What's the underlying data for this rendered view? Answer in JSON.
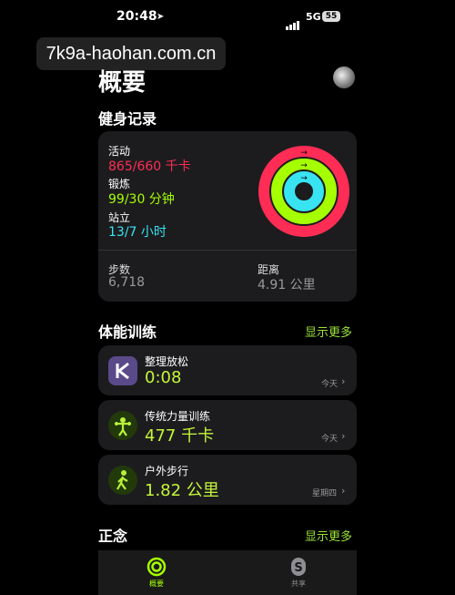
{
  "status": {
    "time": "20:48",
    "network": "5G",
    "battery": "55"
  },
  "watermark": "7k9a-haohan.com.cn",
  "header": {
    "title": "概要"
  },
  "fitness": {
    "section_title": "健身记录",
    "move": {
      "label": "活动",
      "value": "865/660 千卡"
    },
    "exercise": {
      "label": "锻炼",
      "value": "99/30 分钟"
    },
    "stand": {
      "label": "站立",
      "value": "13/7 小时"
    },
    "steps": {
      "label": "步数",
      "value": "6,718"
    },
    "distance": {
      "label": "距离",
      "value": "4.91 公里"
    },
    "ring_colors": {
      "move": "#ff2d55",
      "exercise": "#a6ff00",
      "stand": "#38e4f2"
    }
  },
  "workouts": {
    "section_title": "体能训练",
    "more": "显示更多",
    "items": [
      {
        "name": "整理放松",
        "value": "0:08",
        "date": "今天",
        "icon": "cooldown-k-icon"
      },
      {
        "name": "传统力量训练",
        "value": "477 千卡",
        "date": "今天",
        "icon": "weightlifting-icon"
      },
      {
        "name": "户外步行",
        "value": "1.82 公里",
        "date": "星期四",
        "icon": "walking-icon"
      }
    ]
  },
  "mindfulness": {
    "section_title": "正念",
    "more": "显示更多"
  },
  "tabs": [
    {
      "label": "概要",
      "active": true
    },
    {
      "label": "共享",
      "active": false
    }
  ]
}
